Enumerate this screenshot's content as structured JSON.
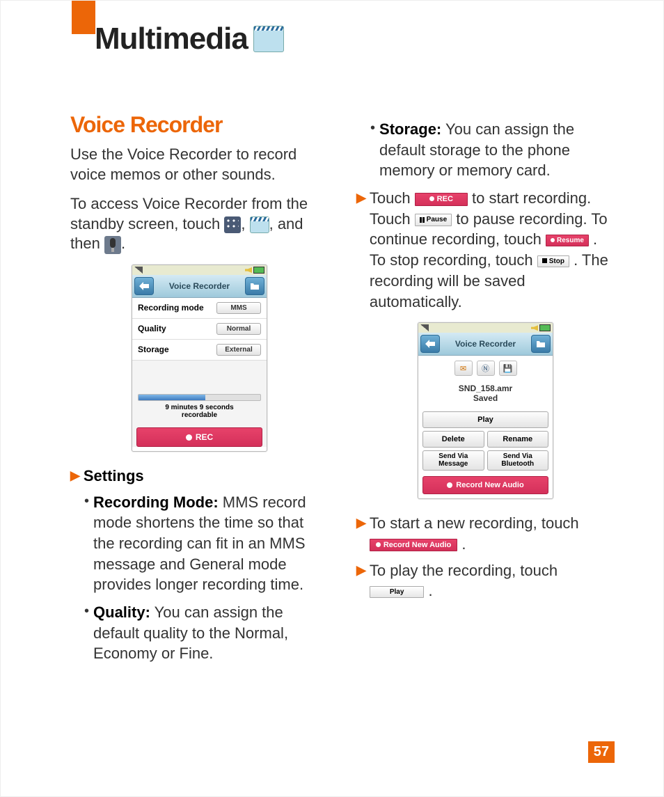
{
  "header": {
    "title": "Multimedia"
  },
  "section": {
    "title": "Voice Recorder"
  },
  "intro1": "Use the Voice Recorder to record voice memos or other sounds.",
  "intro2a": "To access Voice Recorder from the standby screen, touch ",
  "intro2b": ", ",
  "intro2c": ", and then ",
  "intro2d": ".",
  "settings_heading": "Settings",
  "bullets1": {
    "rec_mode_label": "Recording Mode:",
    "rec_mode_text": " MMS record mode shortens the time so that the recording can fit in an MMS message and General mode provides longer recording time.",
    "quality_label": "Quality:",
    "quality_text": " You can assign the default quality to the Normal, Economy or Fine."
  },
  "bullets2": {
    "storage_label": "Storage:",
    "storage_text": " You can assign the default storage to the phone memory or memory card."
  },
  "touch_flow": {
    "t1": "Touch ",
    "rec": "REC",
    "t2": " to start recording. Touch ",
    "pause": "Pause",
    "t3": " to pause recording. To continue recording, touch ",
    "resume": "Resume",
    "t4": ". To stop recording, touch ",
    "stop": "Stop",
    "t5": ". The recording will be saved automatically."
  },
  "end1a": "To start a new recording, touch ",
  "end1btn": "Record New Audio",
  "end1b": ".",
  "end2a": "To play the recording, touch ",
  "end2btn": "Play",
  "end2b": ".",
  "phone1": {
    "title": "Voice Recorder",
    "r1l": "Recording mode",
    "r1v": "MMS",
    "r2l": "Quality",
    "r2v": "Normal",
    "r3l": "Storage",
    "r3v": "External",
    "timer1": "9 minutes 9 seconds",
    "timer2": "recordable",
    "rec": "REC"
  },
  "phone2": {
    "title": "Voice Recorder",
    "file": "SND_158.amr",
    "saved": "Saved",
    "play": "Play",
    "delete": "Delete",
    "rename": "Rename",
    "sendmsg1": "Send Via",
    "sendmsg2": "Message",
    "sendbt1": "Send Via",
    "sendbt2": "Bluetooth",
    "recnew": "Record New Audio"
  },
  "page_number": "57"
}
